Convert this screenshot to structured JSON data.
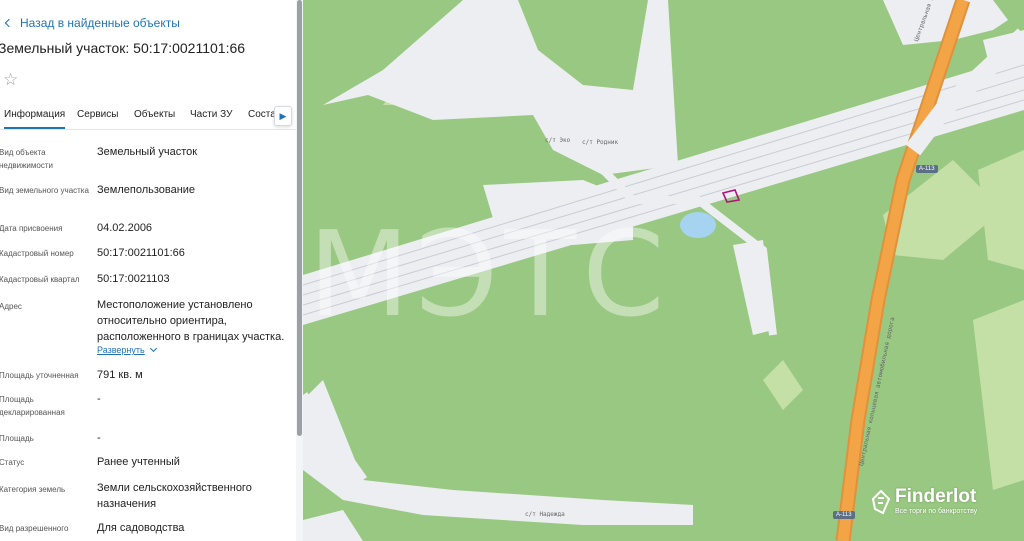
{
  "nav": {
    "back_label": "Назад в найденные объекты"
  },
  "header": {
    "title": "Земельный участок: 50:17:0021101:66"
  },
  "tabs": [
    {
      "label": "Информация"
    },
    {
      "label": "Сервисы"
    },
    {
      "label": "Объекты"
    },
    {
      "label": "Части ЗУ"
    },
    {
      "label": "Соста"
    }
  ],
  "fields": [
    {
      "label": "Вид объекта недвижимости",
      "value": "Земельный участок"
    },
    {
      "label": "Вид земельного участка",
      "value": "Землепользование"
    },
    {
      "label": "Дата присвоения",
      "value": "04.02.2006"
    },
    {
      "label": "Кадастровый номер",
      "value": "50:17:0021101:66"
    },
    {
      "label": "Кадастровый квартал",
      "value": "50:17:0021103"
    },
    {
      "label": "Адрес",
      "value": "Местоположение установлено относительно ориентира, расположенного в границах участка."
    },
    {
      "label": "Площадь уточненная",
      "value": "791 кв. м"
    },
    {
      "label": "Площадь декларированная",
      "value": "-"
    },
    {
      "label": "Площадь",
      "value": "-"
    },
    {
      "label": "Статус",
      "value": "Ранее учтенный"
    },
    {
      "label": "Категория земель",
      "value": "Земли сельскохозяйственного назначения"
    },
    {
      "label": "Вид разрешенного",
      "value": "Для садоводства"
    }
  ],
  "address_expand_label": "Развернуть",
  "map": {
    "labels": {
      "eko": "с/т Эко",
      "rodnik": "с/т Родник",
      "nadezhda": "с/т Надежда",
      "road_name_upper": "Центральная кольцевая автомобильная дорога",
      "road_name_lower": "Центральная кольцевая автомобильная дорога"
    },
    "shields": {
      "a113_top": "А-113",
      "a113_bottom": "А-113"
    },
    "watermark": "МЭТС",
    "brand": {
      "name": "Finderlot",
      "tagline": "Все торги по банкротству"
    },
    "colors": {
      "forest": "#99c882",
      "meadow": "#c4e0a6",
      "road": "#eceef2",
      "highway": "#f3a447",
      "water": "#a6d3ef",
      "parcel_border": "#b3127a"
    }
  }
}
